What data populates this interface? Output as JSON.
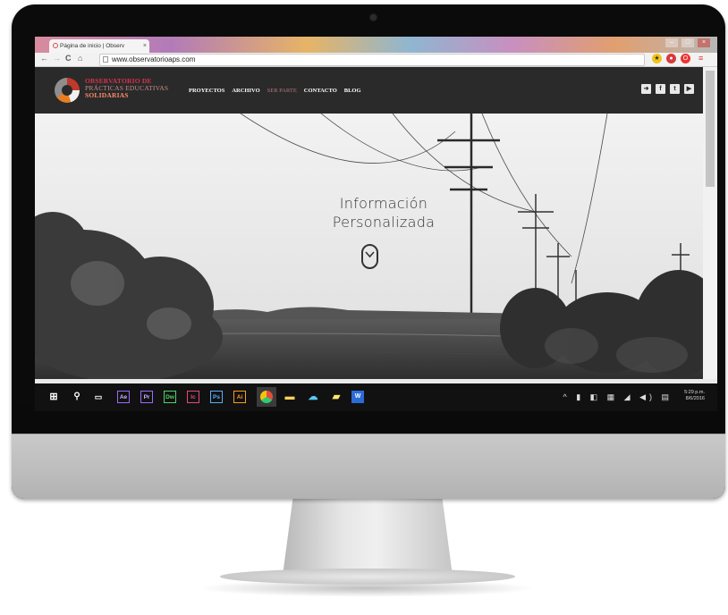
{
  "browser": {
    "tab_title": "Página de inicio | Observ",
    "tab_close": "×",
    "url": "www.observatorioaps.com",
    "nav_back": "←",
    "nav_forward": "→",
    "nav_reload": "C",
    "nav_home": "⌂"
  },
  "site": {
    "brand_line1": "OBSERVATORIO DE",
    "brand_line2": "PRÁCTICAS EDUCATIVAS",
    "brand_line3": "SOLIDARIAS",
    "nav_items": [
      "PROYECTOS",
      "ARCHIVO",
      "SER PARTE",
      "CONTACTO",
      "BLOG"
    ],
    "social_icons": [
      "login-icon",
      "facebook-icon",
      "twitter-icon",
      "youtube-icon"
    ],
    "colors": {
      "header_bg": "#2a2a2a",
      "brand_red": "#d6334b",
      "active_nav": "#b6777d"
    }
  },
  "hero": {
    "title_line1": "Información",
    "title_line2": "Personalizada"
  },
  "taskbar": {
    "apps": [
      "Ae",
      "Pr",
      "Dw",
      "Ic",
      "Ps",
      "Ai"
    ],
    "clock_time": "5:29 p.m.",
    "clock_date": "8/6/2016"
  }
}
